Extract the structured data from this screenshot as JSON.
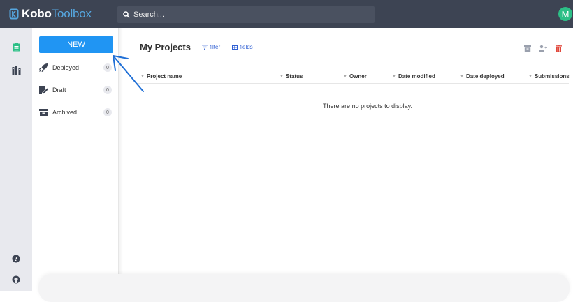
{
  "header": {
    "logo_bold": "Kobo",
    "logo_light": "Toolbox",
    "search_placeholder": "Search...",
    "avatar_initial": "M",
    "avatar_color": "#2cbf86"
  },
  "sidebar": {
    "new_label": "NEW",
    "items": [
      {
        "label": "Deployed",
        "count": "0",
        "icon": "rocket-icon"
      },
      {
        "label": "Draft",
        "count": "0",
        "icon": "pencil-icon"
      },
      {
        "label": "Archived",
        "count": "0",
        "icon": "archive-icon"
      }
    ]
  },
  "main": {
    "title": "My Projects",
    "filter_label": "filter",
    "fields_label": "fields",
    "columns": [
      "Project name",
      "Status",
      "Owner",
      "Date modified",
      "Date deployed",
      "Submissions"
    ],
    "empty_message": "There are no projects to display."
  },
  "colors": {
    "topbar": "#3d4453",
    "accent": "#2095f3",
    "link": "#2f5fd3",
    "delete": "#e0463a"
  }
}
